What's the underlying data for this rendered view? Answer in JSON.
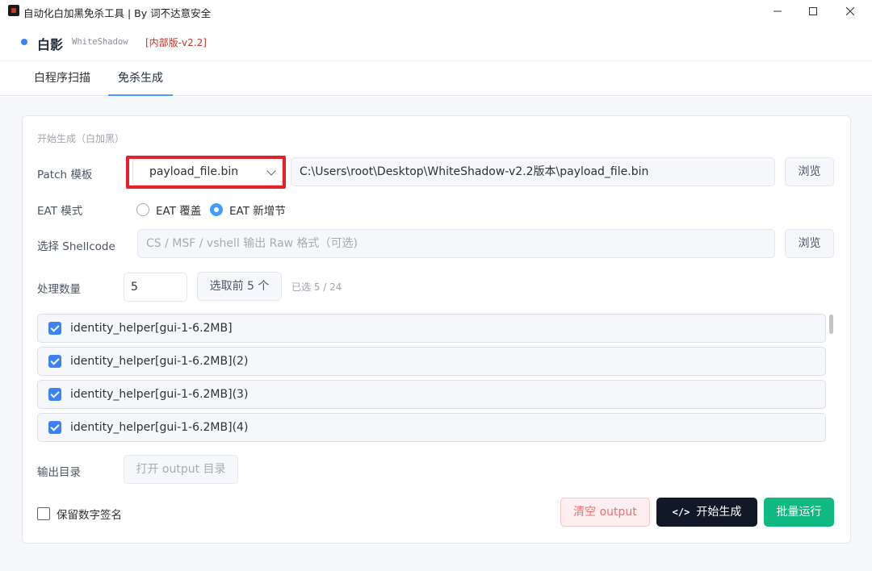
{
  "window": {
    "title": "自动化白加黑免杀工具 | By 词不达意安全",
    "controls": {
      "minimize": "—",
      "maximize": "☐",
      "close": "✕"
    }
  },
  "brand": {
    "name": "白影",
    "subtitle": "WhiteShadow",
    "version": "[内部版-v2.2]"
  },
  "tabs": [
    {
      "label": "白程序扫描",
      "active": false
    },
    {
      "label": "免杀生成",
      "active": true
    }
  ],
  "form": {
    "section_title": "开始生成（白加黑）",
    "patch": {
      "label": "Patch 模板",
      "selected": "payload_file.bin",
      "path": "C:\\Users\\root\\Desktop\\WhiteShadow-v2.2版本\\payload_file.bin",
      "browse": "浏览"
    },
    "eat": {
      "label": "EAT 模式",
      "options": [
        {
          "label": "EAT 覆盖",
          "checked": false
        },
        {
          "label": "EAT 新增节",
          "checked": true
        }
      ]
    },
    "shellcode": {
      "label": "选择 Shellcode",
      "placeholder": "CS / MSF / vshell 输出 Raw 格式（可选)",
      "browse": "浏览"
    },
    "count": {
      "label": "处理数量",
      "value": "5",
      "select_button": "选取前 5 个",
      "selected_status": "已选 5 / 24"
    },
    "items": [
      {
        "label": "identity_helper[gui-1-6.2MB]",
        "checked": true
      },
      {
        "label": "identity_helper[gui-1-6.2MB](2)",
        "checked": true
      },
      {
        "label": "identity_helper[gui-1-6.2MB](3)",
        "checked": true
      },
      {
        "label": "identity_helper[gui-1-6.2MB](4)",
        "checked": true
      }
    ],
    "output": {
      "label": "输出目录",
      "open_button": "打开 output 目录"
    },
    "keep_signature": {
      "label": "保留数字签名",
      "checked": false
    },
    "actions": {
      "clear": "清空 output",
      "generate_icon": "</>",
      "generate": "开始生成",
      "batch": "批量运行"
    }
  },
  "colors": {
    "accent": "#409eff",
    "highlight": "#e5202a",
    "danger": "#f56c6c",
    "success": "#10b981",
    "dark": "#111827"
  }
}
